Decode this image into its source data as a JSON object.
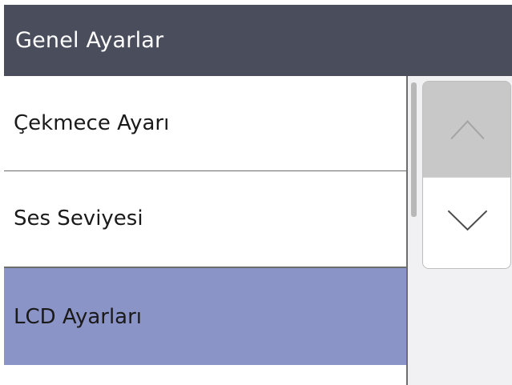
{
  "header": {
    "title": "Genel Ayarlar"
  },
  "menu": {
    "items": [
      {
        "label": "Çekmece Ayarı",
        "selected": false
      },
      {
        "label": "Ses Seviyesi",
        "selected": false
      },
      {
        "label": "LCD Ayarları",
        "selected": true
      }
    ]
  },
  "scroll": {
    "up_icon": "chevron-up-icon",
    "down_icon": "chevron-down-icon",
    "up_enabled": false,
    "down_enabled": true
  },
  "colors": {
    "title_bar": "#4a4d5c",
    "selected_item": "#8b94c6",
    "scroll_background": "#f1f1f3",
    "disabled_button": "#c8c8c8"
  }
}
